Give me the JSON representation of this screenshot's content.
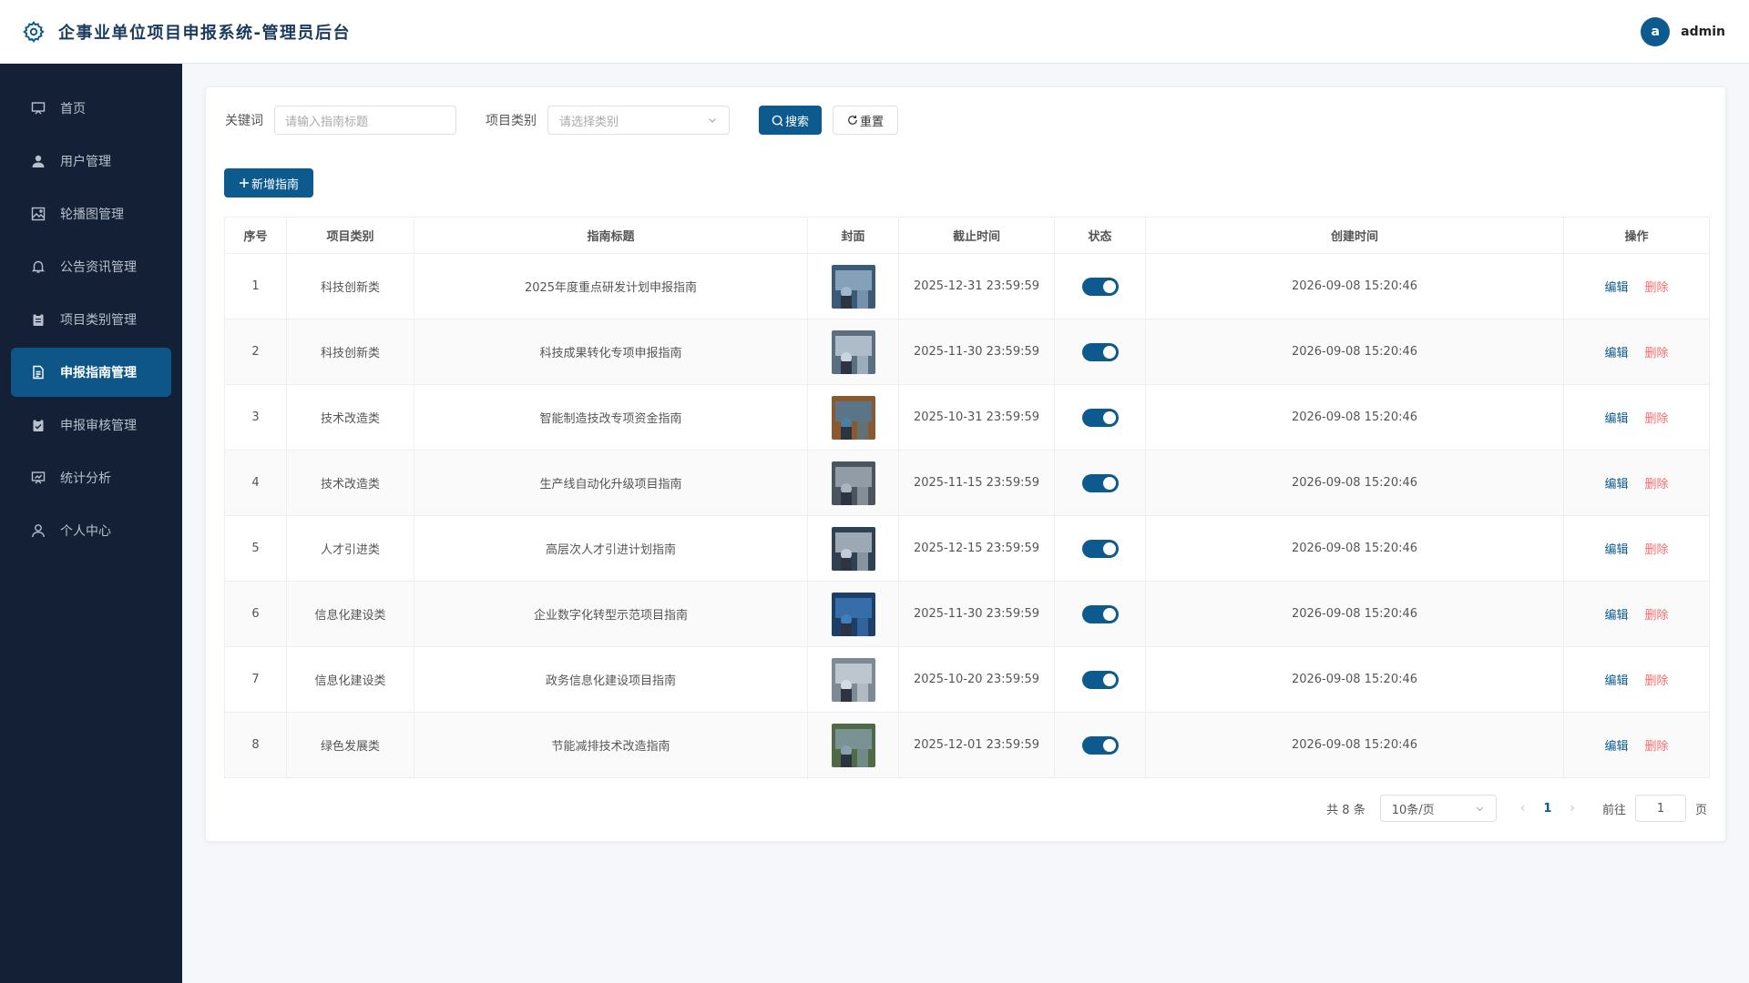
{
  "header": {
    "title": "企事业单位项目申报系统-管理员后台",
    "avatar_letter": "a",
    "username": "admin"
  },
  "sidebar": {
    "items": [
      {
        "label": "首页",
        "icon": "home-icon"
      },
      {
        "label": "用户管理",
        "icon": "user-icon"
      },
      {
        "label": "轮播图管理",
        "icon": "picture-icon"
      },
      {
        "label": "公告资讯管理",
        "icon": "bell-icon"
      },
      {
        "label": "项目类别管理",
        "icon": "clipboard-icon"
      },
      {
        "label": "申报指南管理",
        "icon": "document-icon",
        "active": true
      },
      {
        "label": "申报审核管理",
        "icon": "checklist-icon"
      },
      {
        "label": "统计分析",
        "icon": "chart-icon"
      },
      {
        "label": "个人中心",
        "icon": "person-icon"
      }
    ]
  },
  "filters": {
    "keyword_label": "关键词",
    "keyword_placeholder": "请输入指南标题",
    "category_label": "项目类别",
    "category_placeholder": "请选择类别",
    "search_label": "搜索",
    "reset_label": "重置"
  },
  "add_label": "新增指南",
  "table": {
    "headers": [
      "序号",
      "项目类别",
      "指南标题",
      "封面",
      "截止时间",
      "状态",
      "创建时间",
      "操作"
    ],
    "edit_label": "编辑",
    "delete_label": "删除",
    "rows": [
      {
        "no": "1",
        "category": "科技创新类",
        "title": "2025年度重点研发计划申报指南",
        "deadline": "2025-12-31 23:59:59",
        "enabled": true,
        "created": "2026-09-08 15:20:46"
      },
      {
        "no": "2",
        "category": "科技创新类",
        "title": "科技成果转化专项申报指南",
        "deadline": "2025-11-30 23:59:59",
        "enabled": true,
        "created": "2026-09-08 15:20:46"
      },
      {
        "no": "3",
        "category": "技术改造类",
        "title": "智能制造技改专项资金指南",
        "deadline": "2025-10-31 23:59:59",
        "enabled": true,
        "created": "2026-09-08 15:20:46"
      },
      {
        "no": "4",
        "category": "技术改造类",
        "title": "生产线自动化升级项目指南",
        "deadline": "2025-11-15 23:59:59",
        "enabled": true,
        "created": "2026-09-08 15:20:46"
      },
      {
        "no": "5",
        "category": "人才引进类",
        "title": "高层次人才引进计划指南",
        "deadline": "2025-12-15 23:59:59",
        "enabled": true,
        "created": "2026-09-08 15:20:46"
      },
      {
        "no": "6",
        "category": "信息化建设类",
        "title": "企业数字化转型示范项目指南",
        "deadline": "2025-11-30 23:59:59",
        "enabled": true,
        "created": "2026-09-08 15:20:46"
      },
      {
        "no": "7",
        "category": "信息化建设类",
        "title": "政务信息化建设项目指南",
        "deadline": "2025-10-20 23:59:59",
        "enabled": true,
        "created": "2026-09-08 15:20:46"
      },
      {
        "no": "8",
        "category": "绿色发展类",
        "title": "节能减排技术改造指南",
        "deadline": "2025-12-01 23:59:59",
        "enabled": true,
        "created": "2026-09-08 15:20:46"
      }
    ]
  },
  "pagination": {
    "total_text": "共 8 条",
    "page_size": "10条/页",
    "current_page": "1",
    "goto_label": "前往",
    "goto_value": "1",
    "page_suffix": "页"
  },
  "colors": {
    "primary": "#0d5a8e",
    "sidebar_bg": "#132035",
    "danger": "#f56c6c"
  }
}
